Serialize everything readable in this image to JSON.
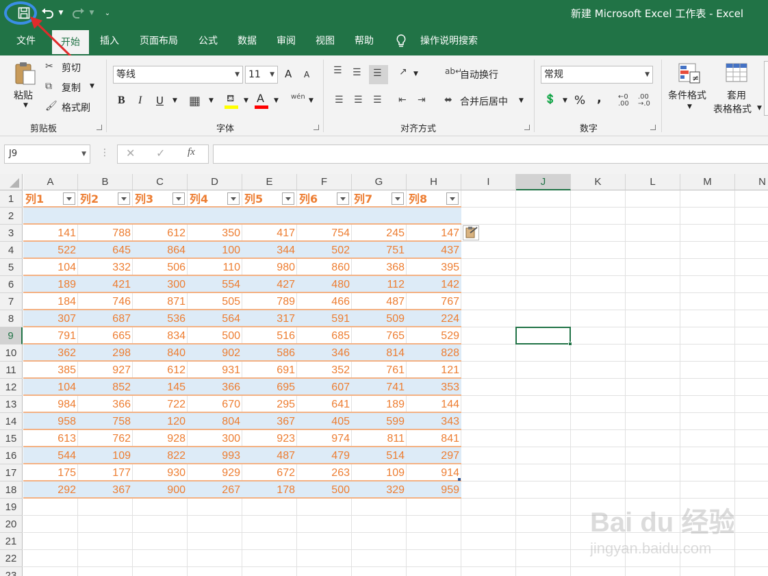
{
  "window": {
    "title": "新建 Microsoft Excel 工作表  -  Excel"
  },
  "quick_access": {
    "icons": [
      "save-icon",
      "undo-icon",
      "redo-icon",
      "customize-icon"
    ]
  },
  "tabs": [
    {
      "label": "文件"
    },
    {
      "label": "开始"
    },
    {
      "label": "插入"
    },
    {
      "label": "页面布局"
    },
    {
      "label": "公式"
    },
    {
      "label": "数据"
    },
    {
      "label": "审阅"
    },
    {
      "label": "视图"
    },
    {
      "label": "帮助"
    },
    {
      "label": "操作说明搜索"
    }
  ],
  "ribbon": {
    "clipboard": {
      "paste": "粘贴",
      "cut": "剪切",
      "copy": "复制",
      "format_painter": "格式刷",
      "group": "剪贴板"
    },
    "font": {
      "name": "等线",
      "size": "11",
      "group": "字体",
      "bold": "B",
      "italic": "I",
      "underline": "U",
      "grow": "A",
      "shrink": "A",
      "phonetic": "wén",
      "font_color": "A"
    },
    "alignment": {
      "wrap": "自动换行",
      "merge": "合并后居中",
      "group": "对齐方式"
    },
    "number": {
      "format": "常规",
      "group": "数字",
      "percent": "%",
      "comma": ","
    },
    "styles": {
      "conditional": "条件格式",
      "table_format_line1": "套用",
      "table_format_line2": "表格格式"
    }
  },
  "formula_bar": {
    "name_box": "J9",
    "fx": "fx",
    "content": ""
  },
  "grid": {
    "columns": [
      "A",
      "B",
      "C",
      "D",
      "E",
      "F",
      "G",
      "H",
      "I",
      "J",
      "K",
      "L",
      "M",
      "N"
    ],
    "rows": [
      "1",
      "2",
      "3",
      "4",
      "5",
      "6",
      "7",
      "8",
      "9",
      "10",
      "11",
      "12",
      "13",
      "14",
      "15",
      "16",
      "17",
      "18",
      "19",
      "20",
      "21",
      "22",
      "23"
    ],
    "selected_column": "J",
    "selected_row": "9",
    "table_headers": [
      "列1",
      "列2",
      "列3",
      "列4",
      "列5",
      "列6",
      "列7",
      "列8"
    ],
    "table_rows": [
      [],
      [
        141,
        788,
        612,
        350,
        417,
        754,
        245,
        147
      ],
      [
        522,
        645,
        864,
        100,
        344,
        502,
        751,
        437
      ],
      [
        104,
        332,
        506,
        110,
        980,
        860,
        368,
        395
      ],
      [
        189,
        421,
        300,
        554,
        427,
        480,
        112,
        142
      ],
      [
        184,
        746,
        871,
        505,
        789,
        466,
        487,
        767
      ],
      [
        307,
        687,
        536,
        564,
        317,
        591,
        509,
        224
      ],
      [
        791,
        665,
        834,
        500,
        516,
        685,
        765,
        529
      ],
      [
        362,
        298,
        840,
        902,
        586,
        346,
        814,
        828
      ],
      [
        385,
        927,
        612,
        931,
        691,
        352,
        761,
        121
      ],
      [
        104,
        852,
        145,
        366,
        695,
        607,
        741,
        353
      ],
      [
        984,
        366,
        722,
        670,
        295,
        641,
        189,
        144
      ],
      [
        958,
        758,
        120,
        804,
        367,
        405,
        599,
        343
      ],
      [
        613,
        762,
        928,
        300,
        923,
        974,
        811,
        841
      ],
      [
        544,
        109,
        822,
        993,
        487,
        479,
        514,
        297
      ],
      [
        175,
        177,
        930,
        929,
        672,
        263,
        109,
        914
      ],
      [
        292,
        367,
        900,
        267,
        178,
        500,
        329,
        959
      ]
    ]
  },
  "watermark": {
    "brand": "Bai du 经验",
    "url": "jingyan.baidu.com"
  },
  "colors": {
    "excel_green": "#217346",
    "table_text": "#ed7d31",
    "band": "#ddebf7",
    "highlight": "#3a8ee6",
    "arrow": "#e02b2b"
  }
}
